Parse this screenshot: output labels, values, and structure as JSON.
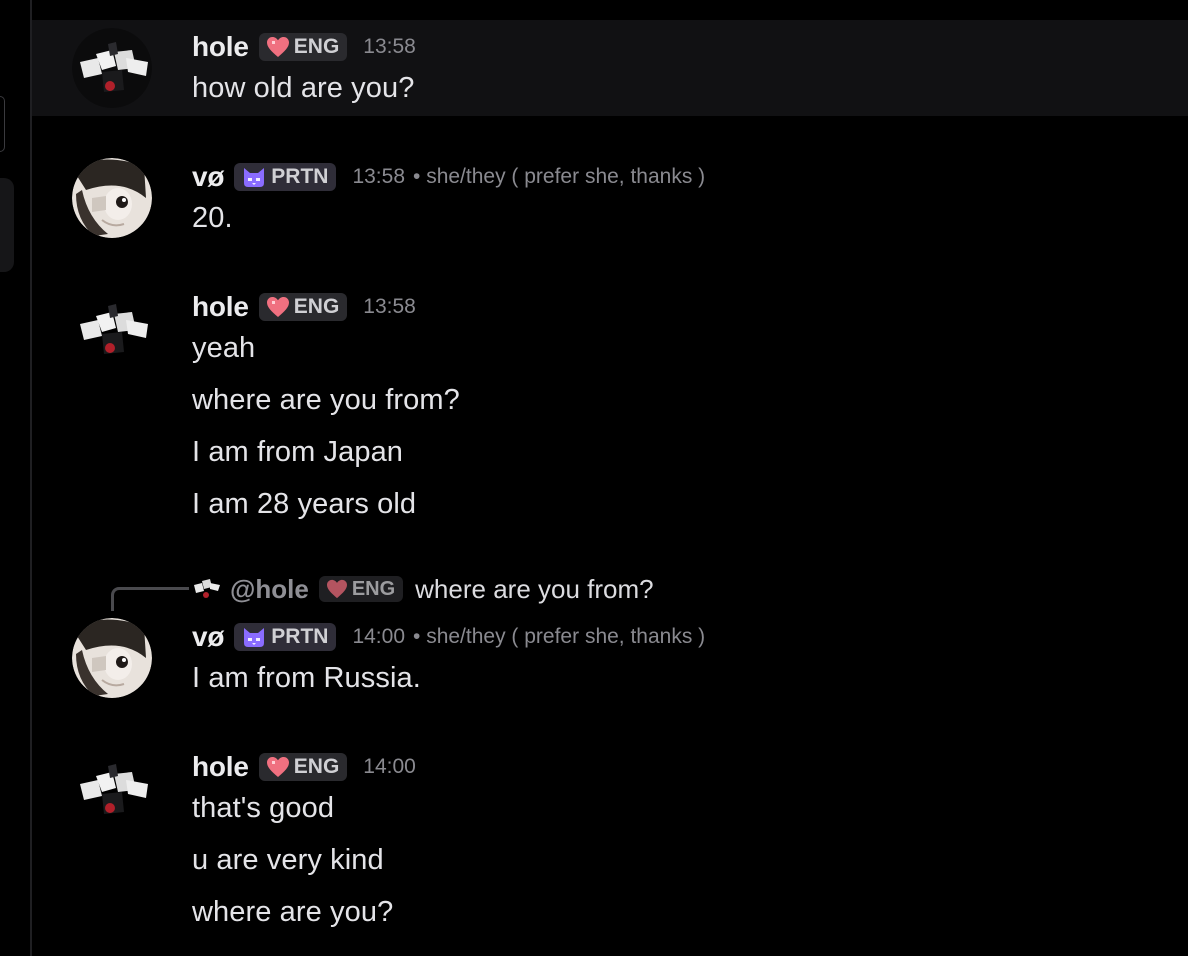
{
  "messages": [
    {
      "author": "hole",
      "badge": "ENG",
      "time": "13:58",
      "lines": [
        "how old are you?"
      ]
    },
    {
      "author": "vø",
      "badge": "PRTN",
      "time": "13:58",
      "pronouns": "• she/they ( prefer she, thanks )",
      "lines": [
        "20."
      ]
    },
    {
      "author": "hole",
      "badge": "ENG",
      "time": "13:58",
      "lines": [
        "yeah",
        "where are you from?",
        "I am from Japan",
        "I am 28 years old"
      ]
    },
    {
      "author": "vø",
      "badge": "PRTN",
      "time": "14:00",
      "pronouns": "• she/they ( prefer she, thanks )",
      "lines": [
        "I am from Russia."
      ],
      "reply": {
        "author": "@hole",
        "badge": "ENG",
        "text": "where are you from?"
      }
    },
    {
      "author": "hole",
      "badge": "ENG",
      "time": "14:00",
      "lines": [
        "that's good",
        "u are very kind",
        "where are you?"
      ]
    }
  ],
  "colors": {
    "background": "#000000",
    "hover_row": "#111113",
    "badge_bg": "#2a2a2e",
    "eng_heart": "#f07080",
    "prtn_icon": "#8a6cff"
  },
  "icons": {
    "eng_badge": "heart-icon",
    "prtn_badge": "cat-icon"
  }
}
